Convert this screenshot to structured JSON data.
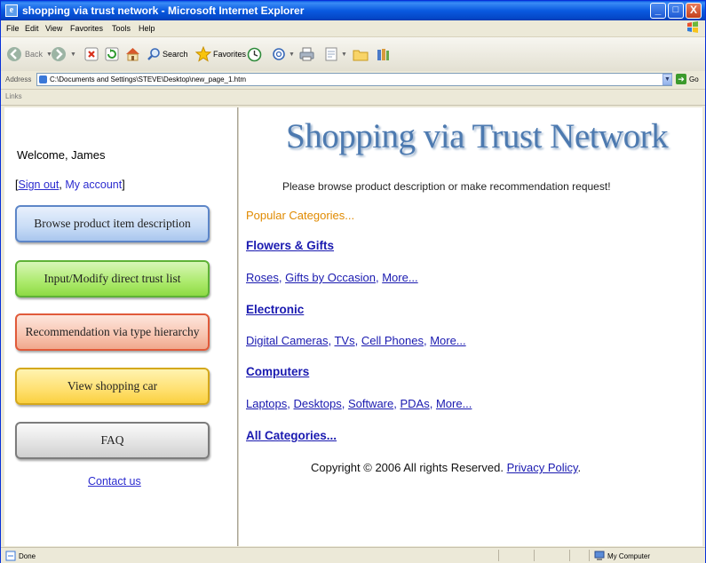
{
  "window": {
    "title": "shopping via trust network - Microsoft Internet Explorer",
    "controls": {
      "minimize": "_",
      "maximize": "□",
      "close": "X"
    }
  },
  "menubar": [
    "File",
    "Edit",
    "View",
    "Favorites",
    "Tools",
    "Help"
  ],
  "toolbar": {
    "back": "Back",
    "search": "Search",
    "favorites": "Favorites"
  },
  "addressbar": {
    "label": "Address",
    "url": "C:\\Documents and Settings\\STEVE\\Desktop\\new_page_1.htm",
    "go_label": "Go"
  },
  "linksbar": {
    "label": "Links"
  },
  "sidebar": {
    "welcome": "Welcome, James",
    "bracket_open": "[",
    "sign_out": "Sign out",
    "comma": ", ",
    "my_account": "My account",
    "bracket_close": "]",
    "buttons": [
      "Browse product item description",
      "Input/Modify direct trust list",
      "Recommendation via type hierarchy",
      "View shopping car",
      "FAQ"
    ],
    "contact": "Contact us"
  },
  "main": {
    "heading": "Shopping via Trust Network",
    "subtitle": "Please browse product description or make recommendation request!",
    "popular": "Popular Categories...",
    "categories": [
      {
        "name": "Flowers & Gifts",
        "links": [
          "Roses",
          "Gifts by Occasion",
          "More..."
        ]
      },
      {
        "name": "Electronic",
        "links": [
          "Digital Cameras",
          "TVs",
          "Cell Phones",
          "More..."
        ]
      },
      {
        "name": "Computers",
        "links": [
          "Laptops",
          "Desktops",
          "Software",
          "PDAs",
          "More..."
        ]
      }
    ],
    "all_categories": "All Categories...",
    "copyright": "Copyright © 2006 All rights Reserved.",
    "privacy": "Privacy Policy",
    "period": "."
  },
  "statusbar": {
    "status": "Done",
    "zone": "My Computer"
  }
}
